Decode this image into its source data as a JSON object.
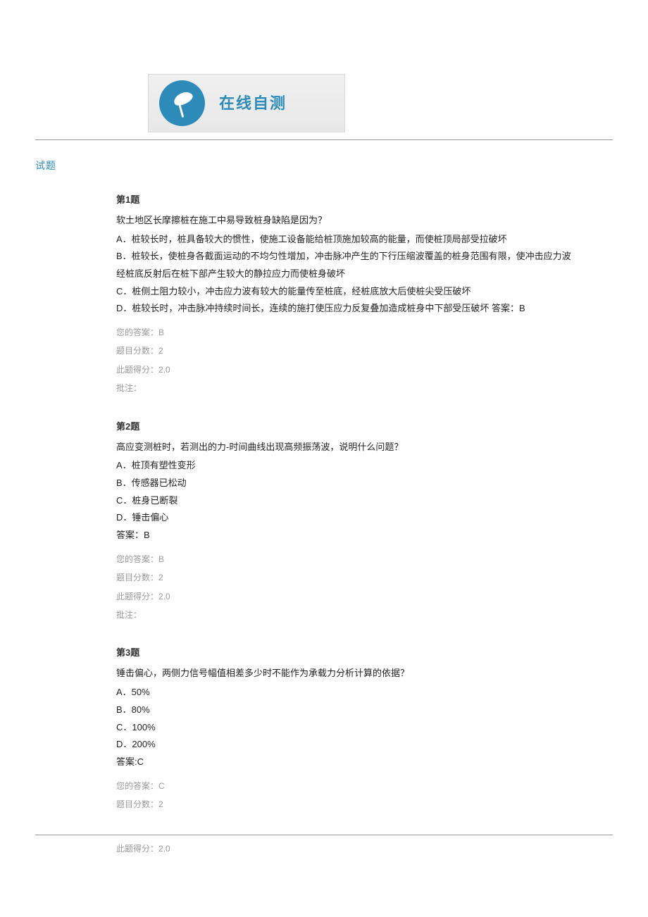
{
  "banner": {
    "title": "在线自测"
  },
  "section_title": "试题",
  "questions": [
    {
      "number": "第1题",
      "prompt": "软土地区长摩擦桩在施工中易导致桩身缺陷是因为？",
      "options": [
        "A．桩较长时，桩具备较大的惯性，使施工设备能给桩顶施加较高的能量，而使桩顶局部受拉破坏",
        "B．桩较长，使桩身各截面运动的不均匀性增加，冲击脉冲产生的下行压缩波覆盖的桩身范围有限，使冲击应力波经桩底反射后在桩下部产生较大的静拉应力而使桩身破坏",
        "C．桩侧土阻力较小，冲击应力波有较大的能量传至桩底，经桩底放大后使桩尖受压破坏",
        "D．桩较长时，冲击脉冲持续时间长，连续的施打使压应力反复叠加造成桩身中下部受压破坏  答案：B"
      ],
      "your_answer_label": "您的答案：",
      "your_answer": "B",
      "score_label": "题目分数：",
      "score_value": "2",
      "got_label": "此题得分：",
      "got_value": "2.0",
      "remark_label": "批注："
    },
    {
      "number": "第2题",
      "prompt": "高应变测桩时，若测出的力-时间曲线出现高频振荡波，说明什么问题？",
      "options": [
        "A．桩顶有塑性变形",
        "B．传感器已松动",
        "C．桩身已断裂",
        "D．锤击偏心"
      ],
      "answer_label": "答案：",
      "answer_value": "B",
      "your_answer_label": "您的答案：",
      "your_answer": "B",
      "score_label": "题目分数：",
      "score_value": "2",
      "got_label": "此题得分：",
      "got_value": "2.0",
      "remark_label": "批注："
    },
    {
      "number": "第3题",
      "prompt": "锤击偏心，两侧力信号幅值相差多少时不能作为承载力分析计算的依据？",
      "options": [
        "A．50%",
        "B．80%",
        "C．100%",
        "D．200%"
      ],
      "answer_label": "答案:",
      "answer_value": "C",
      "your_answer_label": "您的答案：",
      "your_answer": "C",
      "score_label": "题目分数：",
      "score_value": "2",
      "got_label": "此题得分：",
      "got_value": "2.0"
    }
  ]
}
